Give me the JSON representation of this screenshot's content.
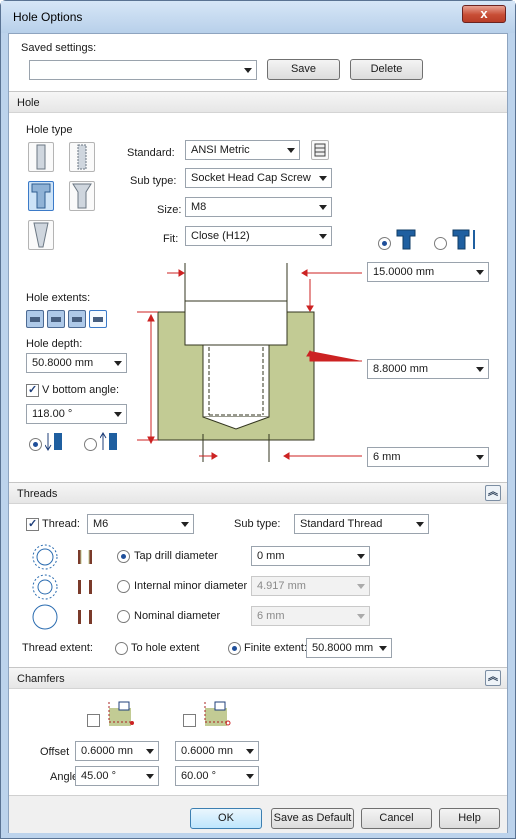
{
  "window": {
    "title": "Hole Options",
    "close": "x"
  },
  "saved": {
    "label": "Saved settings:",
    "value": "",
    "save": "Save",
    "delete": "Delete"
  },
  "hole": {
    "header": "Hole",
    "type_label": "Hole type",
    "standard_label": "Standard:",
    "standard": "ANSI Metric",
    "subtype_label": "Sub type:",
    "subtype": "Socket Head Cap Screw",
    "size_label": "Size:",
    "size": "M8",
    "fit_label": "Fit:",
    "fit": "Close (H12)",
    "extents_label": "Hole extents:",
    "depth_label": "Hole depth:",
    "depth": "50.8000 mm",
    "vbottom_label": "V bottom angle:",
    "vbottom_checked": true,
    "vbottom": "118.00 °",
    "dim_top": "15.0000 mm",
    "dim_mid": "8.8000 mm",
    "dim_bot": "6 mm"
  },
  "threads": {
    "header": "Threads",
    "thread_label": "Thread:",
    "thread_checked": true,
    "thread": "M6",
    "subtype_label": "Sub type:",
    "subtype": "Standard Thread",
    "tap_label": "Tap drill diameter",
    "tap": "0 mm",
    "minor_label": "Internal minor diameter",
    "minor": "4.917 mm",
    "nominal_label": "Nominal diameter",
    "nominal": "6 mm",
    "extent_label": "Thread extent:",
    "to_hole": "To hole extent",
    "finite": "Finite extent:",
    "finite_value": "50.8000 mm"
  },
  "chamfers": {
    "header": "Chamfers",
    "offset_label": "Offset",
    "angle_label": "Angle",
    "offset1": "0.6000 mn",
    "offset2": "0.6000 mn",
    "angle1": "45.00 °",
    "angle2": "60.00 °"
  },
  "buttons": {
    "ok": "OK",
    "save_default": "Save as Default",
    "cancel": "Cancel",
    "help": "Help"
  },
  "colors": {
    "diagram_fill": "#c2cb94",
    "arrow": "#cc2222",
    "selected_icon": "#cde3f7"
  }
}
